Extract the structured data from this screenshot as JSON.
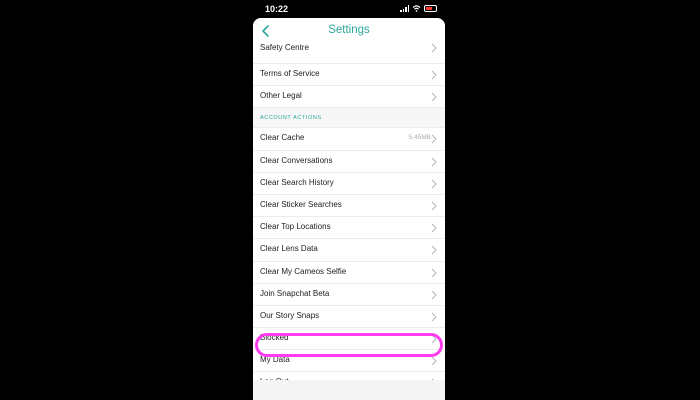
{
  "status": {
    "time": "10:22"
  },
  "nav": {
    "title": "Settings"
  },
  "top_items": [
    {
      "label": "Safety Centre"
    },
    {
      "label": "Terms of Service"
    },
    {
      "label": "Other Legal"
    }
  ],
  "section": {
    "label": "ACCOUNT ACTIONS"
  },
  "items": [
    {
      "label": "Clear Cache",
      "value": "5.45MB"
    },
    {
      "label": "Clear Conversations"
    },
    {
      "label": "Clear Search History"
    },
    {
      "label": "Clear Sticker Searches"
    },
    {
      "label": "Clear Top Locations"
    },
    {
      "label": "Clear Lens Data"
    },
    {
      "label": "Clear My Cameos Selfie"
    },
    {
      "label": "Join Snapchat Beta"
    },
    {
      "label": "Our Story Snaps"
    },
    {
      "label": "Blocked"
    },
    {
      "label": "My Data"
    },
    {
      "label": "Log Out"
    }
  ],
  "colors": {
    "accent": "#2aa79b",
    "highlight": "#ff3cf0",
    "battery": "#ff3b30"
  }
}
